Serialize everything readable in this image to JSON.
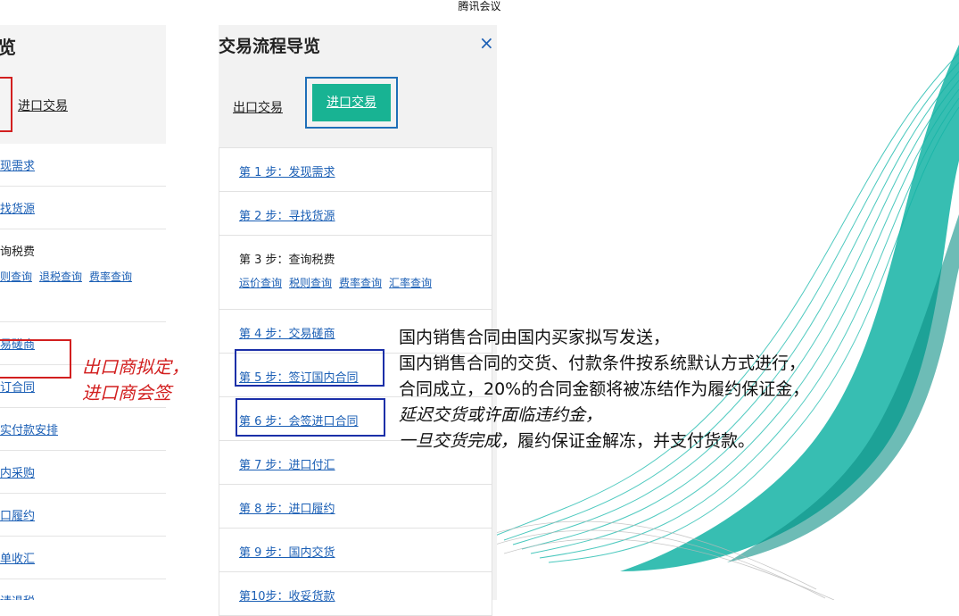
{
  "app_title": "腾讯会议",
  "left_panel": {
    "title": "览",
    "tab": "进口交易",
    "items": [
      {
        "label": "现需求"
      },
      {
        "label": "找货源"
      },
      {
        "label": "询税费",
        "sub": [
          "则查询",
          "退税查询",
          "费率查询"
        ]
      },
      {
        "label": "易磋商"
      },
      {
        "label": "订合同"
      },
      {
        "label": "实付款安排"
      },
      {
        "label": "内采购"
      },
      {
        "label": "口履约"
      },
      {
        "label": "单收汇"
      },
      {
        "label": "请退税"
      }
    ]
  },
  "red_note": [
    "出口商拟定，",
    "进口商会签"
  ],
  "panel": {
    "title": "交易流程导览",
    "close_icon": "×",
    "tabs": {
      "export": "出口交易",
      "import": "进口交易"
    },
    "steps": [
      {
        "label": "第 1 步：发现需求"
      },
      {
        "label": "第 2 步：寻找货源"
      },
      {
        "label": "第 3 步：查询税费",
        "sub": [
          "运价查询",
          "税则查询",
          "费率查询",
          "汇率查询"
        ]
      },
      {
        "label": "第 4 步：交易磋商"
      },
      {
        "label": "第 5 步：签订国内合同"
      },
      {
        "label": "第 6 步：会签进口合同"
      },
      {
        "label": "第 7 步：进口付汇"
      },
      {
        "label": "第 8 步：进口履约"
      },
      {
        "label": "第 9 步：国内交货"
      },
      {
        "label": "第10步：收妥货款"
      }
    ]
  },
  "callout": [
    "国内销售合同由国内买家拟写发送，",
    "国内销售合同的交货、付款条件按系统默认方式进行，",
    "合同成立，20%的合同金额将被冻结作为履约保证金，",
    "延迟交货或许面临违约金，",
    "一旦交货完成，履约保证金解冻，并支付货款。"
  ],
  "colors": {
    "accent": "#18b393",
    "link": "#1b5fb5",
    "note": "#d21f1f"
  }
}
